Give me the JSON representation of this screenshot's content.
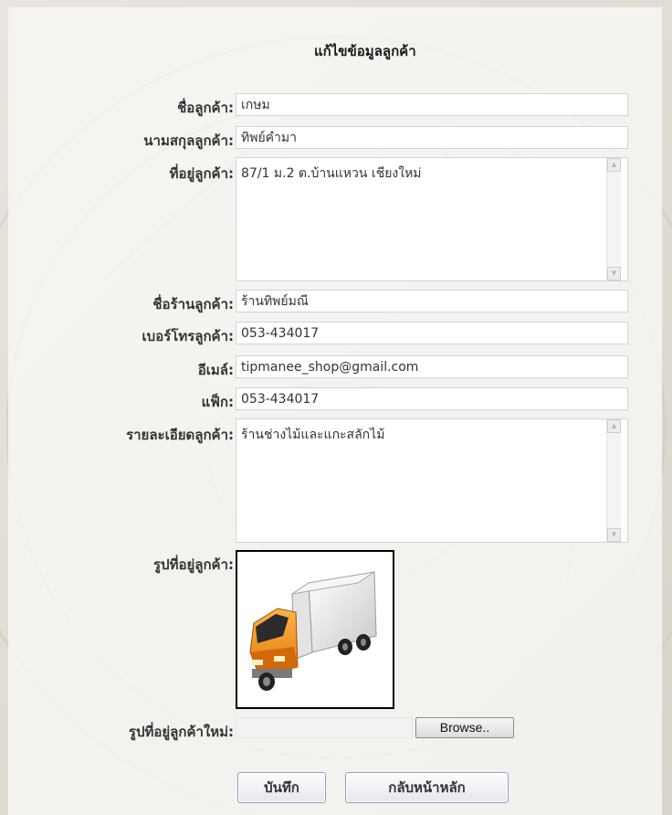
{
  "form": {
    "title": "แก้ไขข้อมูลลูกค้า",
    "fields": [
      {
        "label": "ชื่อลูกค้า:",
        "value": "เกษม"
      },
      {
        "label": "นามสกุลลูกค้า:",
        "value": "ทิพย์คำมา"
      },
      {
        "label": "ที่อยู่ลูกค้า:",
        "value": "87/1 ม.2 ต.บ้านแหวน เชียงใหม่"
      },
      {
        "label": "ชื่อร้านลูกค้า:",
        "value": "ร้านทิพย์มณี"
      },
      {
        "label": "เบอร์โทรลูกค้า:",
        "value": "053-434017"
      },
      {
        "label": "อีเมล์:",
        "value": "tipmanee_shop@gmail.com"
      },
      {
        "label": "แฟ็ก:",
        "value": "053-434017"
      },
      {
        "label": "รายละเอียดลูกค้า:",
        "value": "ร้านช่างไม้และแกะสลักไม้"
      }
    ],
    "photo": {
      "label": "รูปที่อยู่ลูกค้า:",
      "image": "orange-delivery-truck-icon"
    },
    "new_photo": {
      "label": "รูปที่อยู่ลูกค้าใหม่:",
      "browse_label": "Browse..",
      "value": ""
    },
    "buttons": {
      "save": "บันทึก",
      "back": "กลับหน้าหลัก"
    }
  },
  "colors": {
    "background": "#e3dfd7",
    "panel": "#faf9f6",
    "label": "#333333",
    "button_border": "#8fa2bc"
  }
}
